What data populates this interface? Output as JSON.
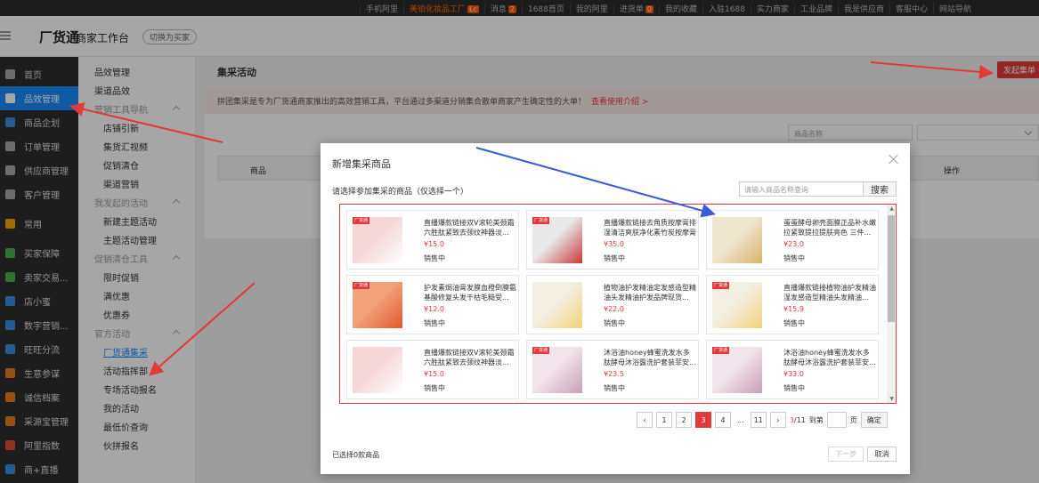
{
  "topbar": {
    "items": [
      "手机阿里",
      "美铂化妆品工厂",
      "消息",
      "1688首页",
      "我的阿里",
      "进货单",
      "我的收藏",
      "入驻1688",
      "实力商家",
      "工业品牌",
      "我是供应商",
      "客服中心",
      "网站导航"
    ],
    "badge_lc": "Lc",
    "badge_msg": "2",
    "badge_cart": "0"
  },
  "header": {
    "logo": "厂货通",
    "subtitle": "商家工作台",
    "switch_label": "切换为买家"
  },
  "sidebar1": [
    {
      "label": "首页",
      "icon": "home-icon"
    },
    {
      "label": "品效管理",
      "icon": "chart-icon",
      "active": true
    },
    {
      "label": "商品企划",
      "icon": "product-icon"
    },
    {
      "label": "订单管理",
      "icon": "order-icon"
    },
    {
      "label": "供应商管理",
      "icon": "supplier-icon"
    },
    {
      "label": "客户管理",
      "icon": "customer-icon"
    },
    {
      "label": "常用",
      "icon": "star-icon"
    },
    {
      "label": "买家保障",
      "icon": "shield-icon"
    },
    {
      "label": "卖家交易...",
      "icon": "trade-icon"
    },
    {
      "label": "店小蜜",
      "icon": "bot-icon"
    },
    {
      "label": "数字营销...",
      "icon": "marketing-icon"
    },
    {
      "label": "旺旺分流",
      "icon": "chat-icon"
    },
    {
      "label": "生意参谋",
      "icon": "analytics-icon"
    },
    {
      "label": "诚信档案",
      "icon": "archive-icon"
    },
    {
      "label": "采源宝管理",
      "icon": "source-icon"
    },
    {
      "label": "阿里指数",
      "icon": "index-icon"
    },
    {
      "label": "商+直播",
      "icon": "live-icon"
    }
  ],
  "sidebar2": [
    {
      "label": "品效管理",
      "type": "top"
    },
    {
      "label": "渠道品效",
      "type": "top"
    },
    {
      "label": "营销工具导航",
      "type": "grp"
    },
    {
      "label": "店铺引新",
      "type": "item"
    },
    {
      "label": "集货汇视频",
      "type": "item"
    },
    {
      "label": "促销清仓",
      "type": "item"
    },
    {
      "label": "渠道营销",
      "type": "item"
    },
    {
      "label": "我发起的活动",
      "type": "grp"
    },
    {
      "label": "新建主题活动",
      "type": "item"
    },
    {
      "label": "主题活动管理",
      "type": "item"
    },
    {
      "label": "促销清仓工具",
      "type": "grp"
    },
    {
      "label": "限时促销",
      "type": "item"
    },
    {
      "label": "满优惠",
      "type": "item"
    },
    {
      "label": "优惠券",
      "type": "item"
    },
    {
      "label": "官方活动",
      "type": "grp"
    },
    {
      "label": "厂货通集采",
      "type": "item",
      "active": true
    },
    {
      "label": "活动指挥部",
      "type": "item"
    },
    {
      "label": "专场活动报名",
      "type": "item"
    },
    {
      "label": "我的活动",
      "type": "item"
    },
    {
      "label": "最低价查询",
      "type": "item"
    },
    {
      "label": "伙拼报名",
      "type": "item"
    }
  ],
  "main": {
    "title": "集采活动",
    "launch_button": "发起集单",
    "notice": "拼团集采是专为厂货通商家推出的高效营销工具，平台通过多渠道分销集合散单商家产生确定性的大单！",
    "notice_link": "查看使用介绍 >",
    "search_placeholder": "商品名称",
    "col_product": "商品",
    "col_action": "操作"
  },
  "modal": {
    "title": "新增集采商品",
    "hint": "请选择参加集采的商品（仅选择一个）",
    "search_placeholder": "请输入商品名称查询",
    "search_button": "搜索",
    "products": [
      {
        "title": "直播爆款链接双V滚轮美颈霜六胜肽紧致去颈纹神器淡...",
        "price": "¥15.0",
        "status": "销售中",
        "tag": "厂货通"
      },
      {
        "title": "直播爆款链接去角质按摩膏排湿清洁爽肤净化素竹炭按摩膏",
        "price": "¥35.0",
        "status": "销售中",
        "tag": "厂货通"
      },
      {
        "title": "蛋蛋酵母卵壳面膜正品补水嫩拉紧致提拉提肤亮色 三件...",
        "price": "¥23.0",
        "status": "销售中",
        "tag": ""
      },
      {
        "title": "护发素焗油膏发膜血橙倒膜氨基酸修复头发干枯毛糙受...",
        "price": "¥12.0",
        "status": "销售中",
        "tag": "厂货通"
      },
      {
        "title": "植物油护发精油定发感造型精油头发精油护发品牌现货...",
        "price": "¥22.0",
        "status": "销售中",
        "tag": ""
      },
      {
        "title": "直播爆款链接植物油护发精油湿发感造型精油头发精油...",
        "price": "¥15.9",
        "status": "销售中",
        "tag": "厂货通"
      },
      {
        "title": "直播爆款链接双V滚轮美颈霜六胜肽紧致去颈纹神器淡...",
        "price": "¥15.0",
        "status": "销售中",
        "tag": ""
      },
      {
        "title": "沐浴油honey蜂蜜洗发水多肽酵母沐浴露洗护套装菲安...",
        "price": "¥23.5",
        "status": "销售中",
        "tag": "厂货通"
      },
      {
        "title": "沐浴油honey蜂蜜洗发水多肽酵母沐浴露洗护套装菲安...",
        "price": "¥33.0",
        "status": "销售中",
        "tag": "厂货通"
      }
    ],
    "pagination": {
      "pages": [
        "1",
        "2",
        "3",
        "4",
        "...",
        "11"
      ],
      "current": "3",
      "info_current": "3",
      "info_total": "/11",
      "goto_label": "到第",
      "page_unit": "页",
      "confirm": "确定"
    },
    "selected_count": "已选择0款商品",
    "next_button": "下一步",
    "cancel_button": "取消"
  },
  "colors": {
    "accent": "#e4393c",
    "blue": "#1989fa",
    "sidebar": "#2d2d2d",
    "arrow": "#e4393c",
    "blue_arrow": "#3b5bdb"
  }
}
